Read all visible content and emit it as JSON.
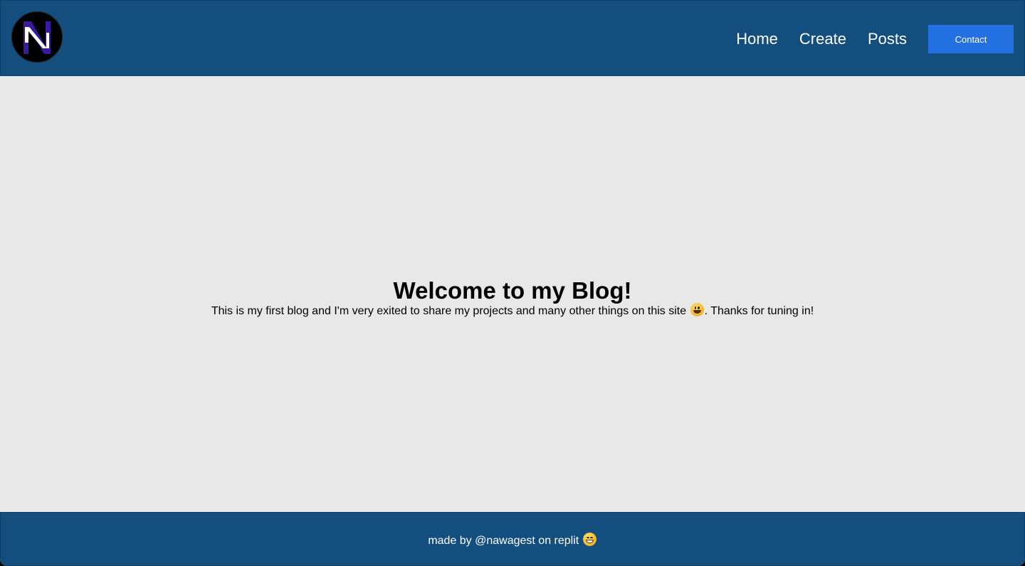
{
  "header": {
    "logo_letter": "N",
    "nav": {
      "home": "Home",
      "create": "Create",
      "posts": "Posts",
      "contact": "Contact"
    }
  },
  "main": {
    "title": "Welcome to my Blog!",
    "intro_before_emoji": "This is my first blog and I'm very exited to share my projects and many other things on this site ",
    "intro_emoji": "smiley-emoji-icon",
    "intro_after_emoji": ". Thanks for tuning in!"
  },
  "footer": {
    "text": "made by @nawagest on replit ",
    "emoji": "grinning-emoji-icon"
  },
  "colors": {
    "header_bg": "#134e7f",
    "footer_bg": "#134e7f",
    "body_bg": "#e8e8e8",
    "contact_button": "#2370e3",
    "logo_accent": "#3a1a9e"
  }
}
